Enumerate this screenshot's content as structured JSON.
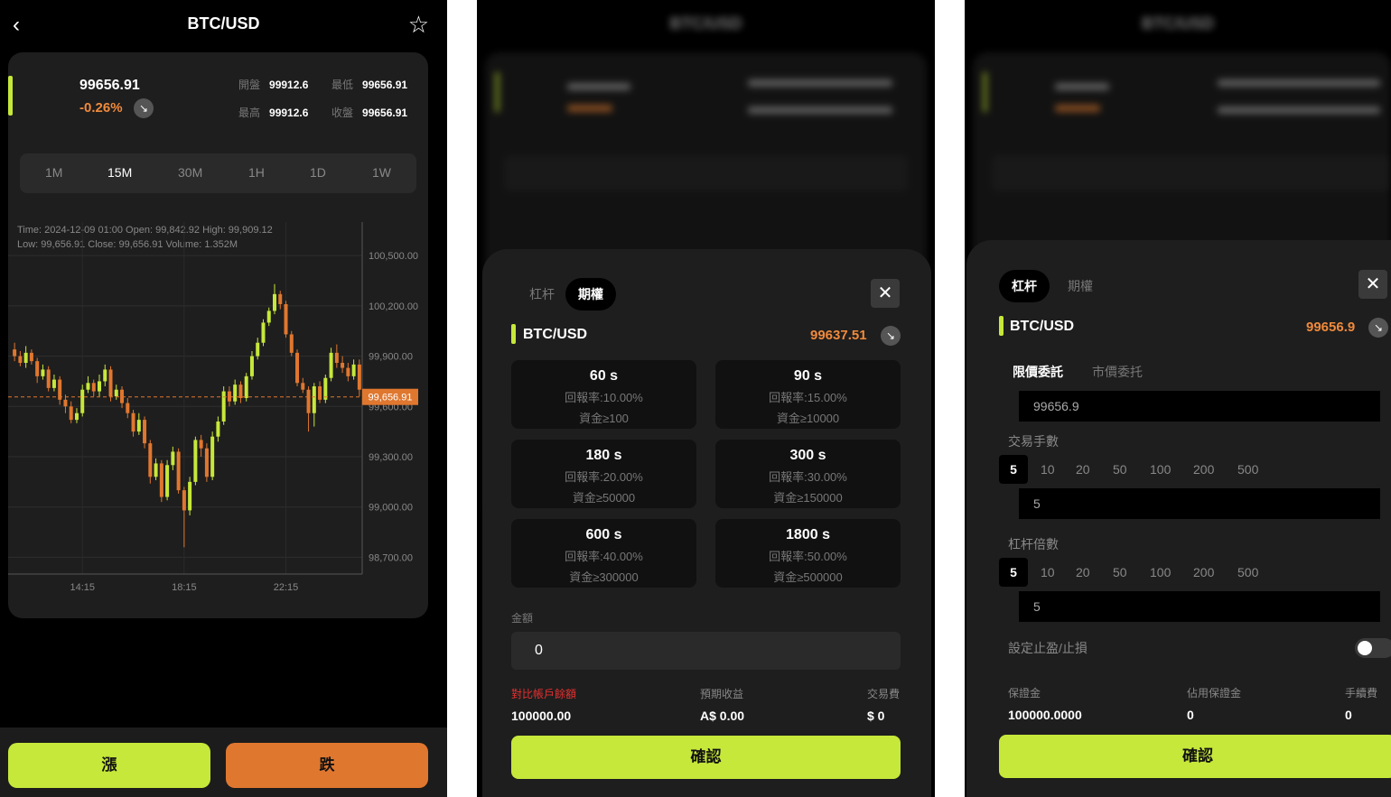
{
  "screen1": {
    "title": "BTC/USD",
    "price": "99656.91",
    "change": "-0.26%",
    "stats": [
      {
        "label": "開盤",
        "value": "99912.6"
      },
      {
        "label": "最低",
        "value": "99656.91"
      },
      {
        "label": "最高",
        "value": "99912.6"
      },
      {
        "label": "收盤",
        "value": "99656.91"
      }
    ],
    "timeframes": [
      "1M",
      "15M",
      "30M",
      "1H",
      "1D",
      "1W"
    ],
    "active_timeframe": "15M",
    "ohlc_line1": "Time: 2024-12-09 01:00    Open: 99,842.92    High: 99,909.12",
    "ohlc_line2": "Low: 99,656.91    Close: 99,656.91    Volume: 1.352M",
    "up_label": "漲",
    "down_label": "跌"
  },
  "chart_data": {
    "type": "candlestick",
    "y_ticks": [
      "100,500.00",
      "100,200.00",
      "99,900.00",
      "99,600.00",
      "99,300.00",
      "99,000.00",
      "98,700.00"
    ],
    "y_tick_values": [
      100500,
      100200,
      99900,
      99600,
      99300,
      99000,
      98700
    ],
    "x_ticks": [
      "14:15",
      "18:15",
      "22:15"
    ],
    "current_price_label": "99,656.91",
    "current_price": 99656.91,
    "ylim": [
      98600,
      100700
    ],
    "candles": [
      [
        99940,
        99900,
        99980,
        99870
      ],
      [
        99900,
        99860,
        99930,
        99840
      ],
      [
        99860,
        99920,
        99960,
        99830
      ],
      [
        99920,
        99870,
        99940,
        99850
      ],
      [
        99870,
        99780,
        99890,
        99740
      ],
      [
        99780,
        99820,
        99850,
        99760
      ],
      [
        99820,
        99710,
        99840,
        99690
      ],
      [
        99710,
        99760,
        99790,
        99690
      ],
      [
        99760,
        99640,
        99780,
        99610
      ],
      [
        99640,
        99600,
        99670,
        99560
      ],
      [
        99600,
        99520,
        99630,
        99500
      ],
      [
        99520,
        99560,
        99590,
        99500
      ],
      [
        99560,
        99700,
        99730,
        99540
      ],
      [
        99700,
        99740,
        99780,
        99680
      ],
      [
        99740,
        99690,
        99760,
        99660
      ],
      [
        99690,
        99750,
        99790,
        99660
      ],
      [
        99750,
        99820,
        99850,
        99720
      ],
      [
        99820,
        99660,
        99840,
        99630
      ],
      [
        99660,
        99700,
        99730,
        99640
      ],
      [
        99700,
        99620,
        99720,
        99590
      ],
      [
        99620,
        99560,
        99650,
        99530
      ],
      [
        99560,
        99450,
        99580,
        99420
      ],
      [
        99450,
        99520,
        99560,
        99430
      ],
      [
        99520,
        99380,
        99540,
        99350
      ],
      [
        99380,
        99180,
        99400,
        99140
      ],
      [
        99180,
        99260,
        99290,
        99160
      ],
      [
        99260,
        99060,
        99280,
        99030
      ],
      [
        99060,
        99250,
        99280,
        99040
      ],
      [
        99250,
        99330,
        99360,
        99220
      ],
      [
        99330,
        99100,
        99350,
        99080
      ],
      [
        99100,
        98980,
        99120,
        98760
      ],
      [
        98980,
        99150,
        99180,
        98950
      ],
      [
        99150,
        99400,
        99420,
        99130
      ],
      [
        99400,
        99350,
        99430,
        99300
      ],
      [
        99350,
        99180,
        99380,
        99150
      ],
      [
        99180,
        99420,
        99450,
        99160
      ],
      [
        99420,
        99510,
        99540,
        99390
      ],
      [
        99510,
        99690,
        99720,
        99490
      ],
      [
        99690,
        99630,
        99720,
        99600
      ],
      [
        99630,
        99730,
        99760,
        99610
      ],
      [
        99730,
        99650,
        99750,
        99620
      ],
      [
        99650,
        99780,
        99800,
        99630
      ],
      [
        99780,
        99900,
        99930,
        99760
      ],
      [
        99900,
        99980,
        100010,
        99880
      ],
      [
        99980,
        100100,
        100120,
        99960
      ],
      [
        100100,
        100170,
        100190,
        100080
      ],
      [
        100170,
        100270,
        100330,
        100150
      ],
      [
        100270,
        100210,
        100290,
        100180
      ],
      [
        100210,
        100030,
        100230,
        100010
      ],
      [
        100030,
        99920,
        100050,
        99900
      ],
      [
        99920,
        99740,
        99940,
        99720
      ],
      [
        99740,
        99700,
        99770,
        99680
      ],
      [
        99700,
        99560,
        99720,
        99450
      ],
      [
        99560,
        99720,
        99740,
        99480
      ],
      [
        99720,
        99640,
        99750,
        99620
      ],
      [
        99640,
        99770,
        99790,
        99620
      ],
      [
        99770,
        99920,
        99950,
        99750
      ],
      [
        99920,
        99860,
        99970,
        99830
      ],
      [
        99860,
        99830,
        99900,
        99800
      ],
      [
        99830,
        99780,
        99860,
        99750
      ],
      [
        99780,
        99850,
        99880,
        99760
      ],
      [
        99850,
        99700,
        99880,
        99660
      ]
    ]
  },
  "screen2": {
    "title": "BTC/USD",
    "tabs": [
      "杠杆",
      "期權"
    ],
    "active_tab": "期權",
    "pair": "BTC/USD",
    "price": "99637.51",
    "options": [
      {
        "time": "60 s",
        "rate": "回報率:10.00%",
        "min": "資金≥100"
      },
      {
        "time": "90 s",
        "rate": "回報率:15.00%",
        "min": "資金≥10000"
      },
      {
        "time": "180 s",
        "rate": "回報率:20.00%",
        "min": "資金≥50000"
      },
      {
        "time": "300 s",
        "rate": "回報率:30.00%",
        "min": "資金≥150000"
      },
      {
        "time": "600 s",
        "rate": "回報率:40.00%",
        "min": "資金≥300000"
      },
      {
        "time": "1800 s",
        "rate": "回報率:50.00%",
        "min": "資金≥500000"
      }
    ],
    "amount_label": "金額",
    "amount_value": "0",
    "balance_label": "對比帳戶餘額",
    "balance_value": "100000.00",
    "expected_label": "預期收益",
    "expected_value": "A$ 0.00",
    "fee_label": "交易費",
    "fee_value": "$ 0",
    "confirm_label": "確認"
  },
  "screen3": {
    "title": "BTC/USD",
    "tabs": [
      "杠杆",
      "期權"
    ],
    "active_tab": "杠杆",
    "pair": "BTC/USD",
    "price": "99656.9",
    "order_tabs": [
      "限價委託",
      "市價委托"
    ],
    "active_order_tab": "限價委託",
    "limit_price": "99656.9",
    "lots_label": "交易手數",
    "lot_options": [
      "5",
      "10",
      "20",
      "50",
      "100",
      "200",
      "500"
    ],
    "lots_value": "5",
    "leverage_label": "杠杆倍數",
    "leverage_options": [
      "5",
      "10",
      "20",
      "50",
      "100",
      "200",
      "500"
    ],
    "leverage_value": "5",
    "tp_sl_label": "設定止盈/止損",
    "margin_label": "保證金",
    "margin_value": "100000.0000",
    "used_margin_label": "佔用保證金",
    "used_margin_value": "0",
    "fee_label": "手續費",
    "fee_value": "0",
    "confirm_label": "確認"
  },
  "colors": {
    "accent_green": "#c6e83a",
    "accent_orange": "#e0772f",
    "price_orange": "#f08a3c",
    "background": "#000000",
    "card": "#1e1e1e"
  },
  "icons": [
    "back-chevron-icon",
    "star-icon",
    "down-right-arrow-icon",
    "close-icon"
  ]
}
